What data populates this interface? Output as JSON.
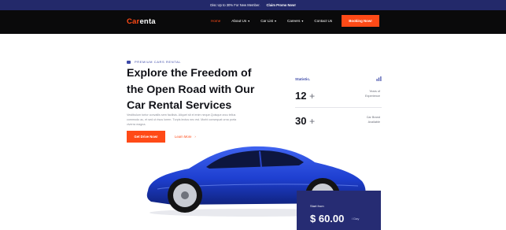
{
  "promo": {
    "text": "Disc Up to 30% For New Member.",
    "link": "Claim Promo Now!"
  },
  "nav": {
    "logo_prefix": "Car",
    "logo_suffix": "enta",
    "items": [
      {
        "label": "Home",
        "dropdown": false,
        "active": true
      },
      {
        "label": "About Us",
        "dropdown": true,
        "active": false
      },
      {
        "label": "Car List",
        "dropdown": true,
        "active": false
      },
      {
        "label": "Careers",
        "dropdown": true,
        "active": false
      },
      {
        "label": "Contact Us",
        "dropdown": false,
        "active": false
      }
    ],
    "book_button": "Booking Now!"
  },
  "hero": {
    "tagline": "PREMIUM CARS RENTAL",
    "headline": "Explore the Freedom of the Open Road with Our Car Rental Services",
    "description": "Vestibulum tortor convallis sem facilisis. Aliquet sit el enim neque.Quisque arcu tellus commodo ac, et sed ut risus lorem. Turpis lectus nec est. Morbi consequat urna porta viverra magna.",
    "cta_button": "Get Drive Now!",
    "learn_more": "Learn More",
    "learn_more_arrow": "›"
  },
  "stats": {
    "title": "Statistic.",
    "items": [
      {
        "value": "12",
        "suffix": "+",
        "label_line1": "Years of",
        "label_line2": "Experience"
      },
      {
        "value": "30",
        "suffix": "+",
        "label_line1": "Car Brand",
        "label_line2": "Available"
      }
    ]
  },
  "price_card": {
    "start_label": "Start from",
    "price": "$ 60.00",
    "per": "/ Day"
  },
  "colors": {
    "accent": "#ff4a17",
    "navy": "#262c73",
    "car_blue": "#1e3fd0"
  }
}
